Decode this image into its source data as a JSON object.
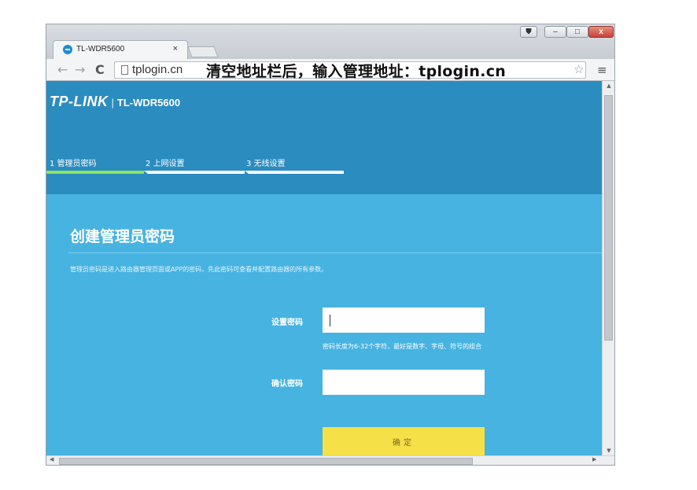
{
  "browser": {
    "tab_title": "TL-WDR5600",
    "tab_close": "×",
    "url": "tplogin.cn",
    "overlay_note": "清空地址栏后，输入管理地址：tplogin.cn",
    "nav_back": "←",
    "nav_forward": "→",
    "reload": "C",
    "star": "☆",
    "menu": "≡",
    "window_controls": {
      "minimize": "–",
      "maximize": "□",
      "close": "x"
    }
  },
  "brand": {
    "logo": "TP-LINK",
    "separator": "|",
    "model": "TL-WDR5600"
  },
  "steps": [
    {
      "label": "1 管理员密码",
      "active": true
    },
    {
      "label": "2 上网设置",
      "active": false
    },
    {
      "label": "3 无线设置",
      "active": false
    }
  ],
  "main": {
    "title": "创建管理员密码",
    "description": "管理员密码是进入路由器管理页面或APP的密码，先此密码可查看并配置路由器的所有参数。",
    "password_label": "设置密码",
    "password_value": "",
    "password_hint": "密码长度为6-32个字符，最好是数字、字母、符号的组合",
    "confirm_label": "确认密码",
    "confirm_value": "",
    "submit_label": "确定"
  },
  "colors": {
    "page_bg": "#47b3e1",
    "header_bg": "#2b8cbf",
    "active_step": "#8fe35a",
    "button": "#f5e048"
  }
}
